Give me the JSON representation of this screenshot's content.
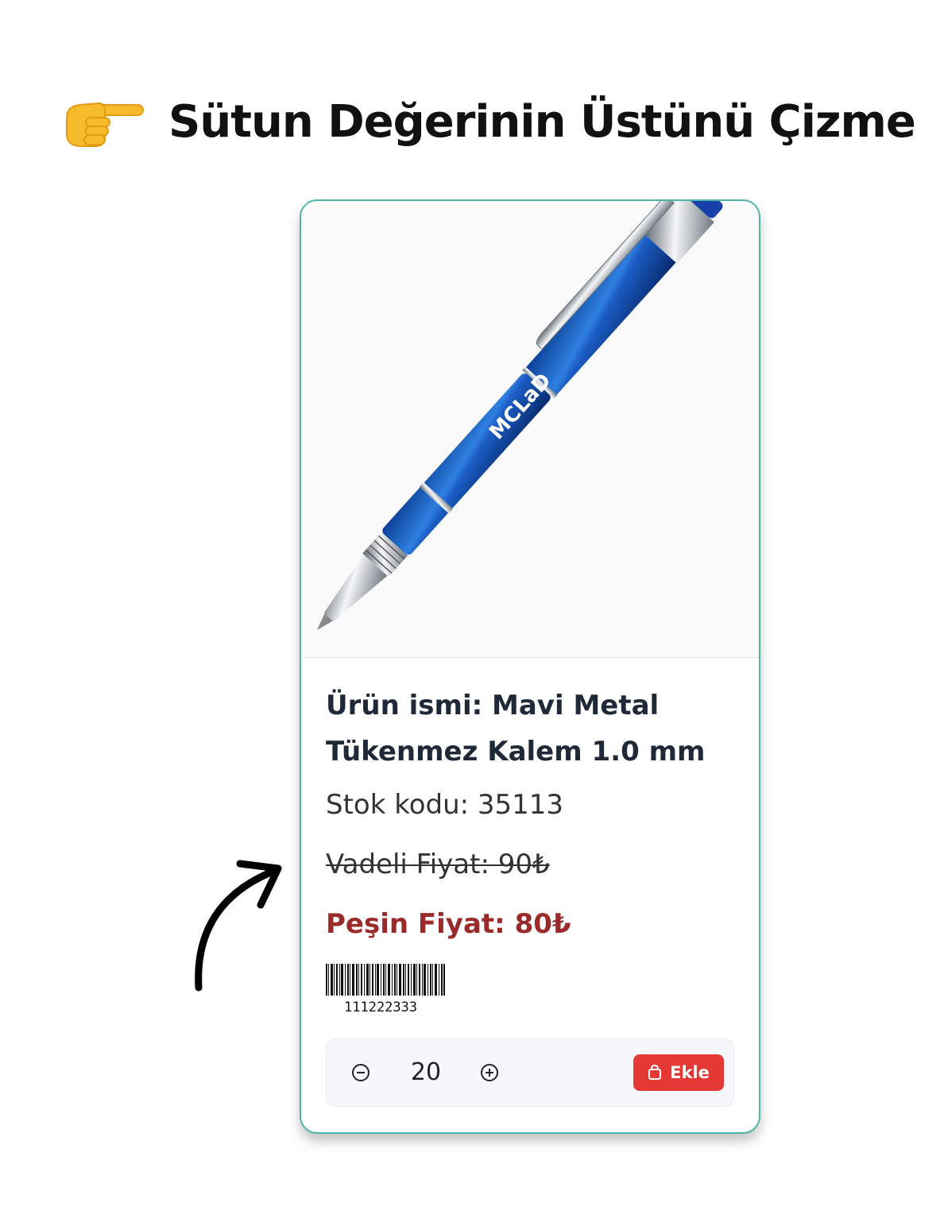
{
  "heading": {
    "icon": "pointing-hand-icon",
    "text": "Sütun Değerinin Üstünü Çizme"
  },
  "product": {
    "image": "blue-metal-pen-image",
    "brand_on_pen": "MCLaD",
    "name": "Ürün ismi: Mavi Metal Tükenmez Kalem 1.0 mm",
    "stock_code": "Stok kodu: 35113",
    "term_price": "Vadeli Fiyat: 90₺",
    "cash_price": "Peşin Fiyat: 80₺",
    "barcode_number": "111222333"
  },
  "cart": {
    "quantity": "20",
    "add_label": "Ekle",
    "add_icon": "shopping-bag-icon"
  },
  "colors": {
    "card_border": "#4fb3a8",
    "cash_price": "#9b2b2b",
    "add_button": "#e53935"
  },
  "annotation": {
    "icon": "curved-arrow-icon"
  }
}
